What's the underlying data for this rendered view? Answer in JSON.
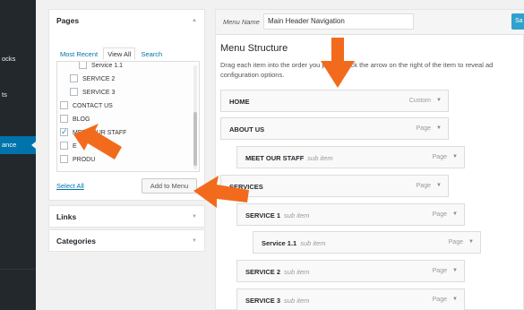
{
  "sidebar": {
    "items": [
      {
        "label": "ocks"
      },
      {
        "label": "ts"
      },
      {
        "label": "ance"
      }
    ]
  },
  "pages_panel": {
    "title": "Pages",
    "tabs": [
      "Most Recent",
      "View All",
      "Search"
    ],
    "items": [
      {
        "label": "Service 1.1",
        "checked": false
      },
      {
        "label": "SERVICE 2",
        "checked": false
      },
      {
        "label": "SERVICE 3",
        "checked": false
      },
      {
        "label": "CONTACT US",
        "checked": false
      },
      {
        "label": "BLOG",
        "checked": false
      },
      {
        "label": "MEET OUR STAFF",
        "checked": true
      },
      {
        "label": "E",
        "checked": false
      },
      {
        "label": "PRODU",
        "checked": false
      }
    ],
    "select_all": "Select All",
    "add_button": "Add to Menu"
  },
  "links_panel": {
    "title": "Links"
  },
  "categories_panel": {
    "title": "Categories"
  },
  "menu_editor": {
    "name_label": "Menu Name",
    "name_value": "Main Header Navigation",
    "save_label": "Sa",
    "structure_title": "Menu Structure",
    "structure_desc": "Drag each item into the order you prefer. Click the arrow on the right of the item to reveal ad configuration options.",
    "items": [
      {
        "title": "HOME",
        "sub": "",
        "type": "Custom"
      },
      {
        "title": "ABOUT US",
        "sub": "",
        "type": "Page"
      },
      {
        "title": "MEET OUR STAFF",
        "sub": "sub item",
        "type": "Page"
      },
      {
        "title": "SERVICES",
        "sub": "",
        "type": "Page"
      },
      {
        "title": "SERVICE 1",
        "sub": "sub item",
        "type": "Page"
      },
      {
        "title": "Service 1.1",
        "sub": "sub item",
        "type": "Page"
      },
      {
        "title": "SERVICE 2",
        "sub": "sub item",
        "type": "Page"
      },
      {
        "title": "SERVICE 3",
        "sub": "sub item",
        "type": "Page"
      }
    ]
  },
  "colors": {
    "accent": "#0073aa",
    "arrow": "#f26b1d",
    "admin_bar": "#23282d"
  }
}
